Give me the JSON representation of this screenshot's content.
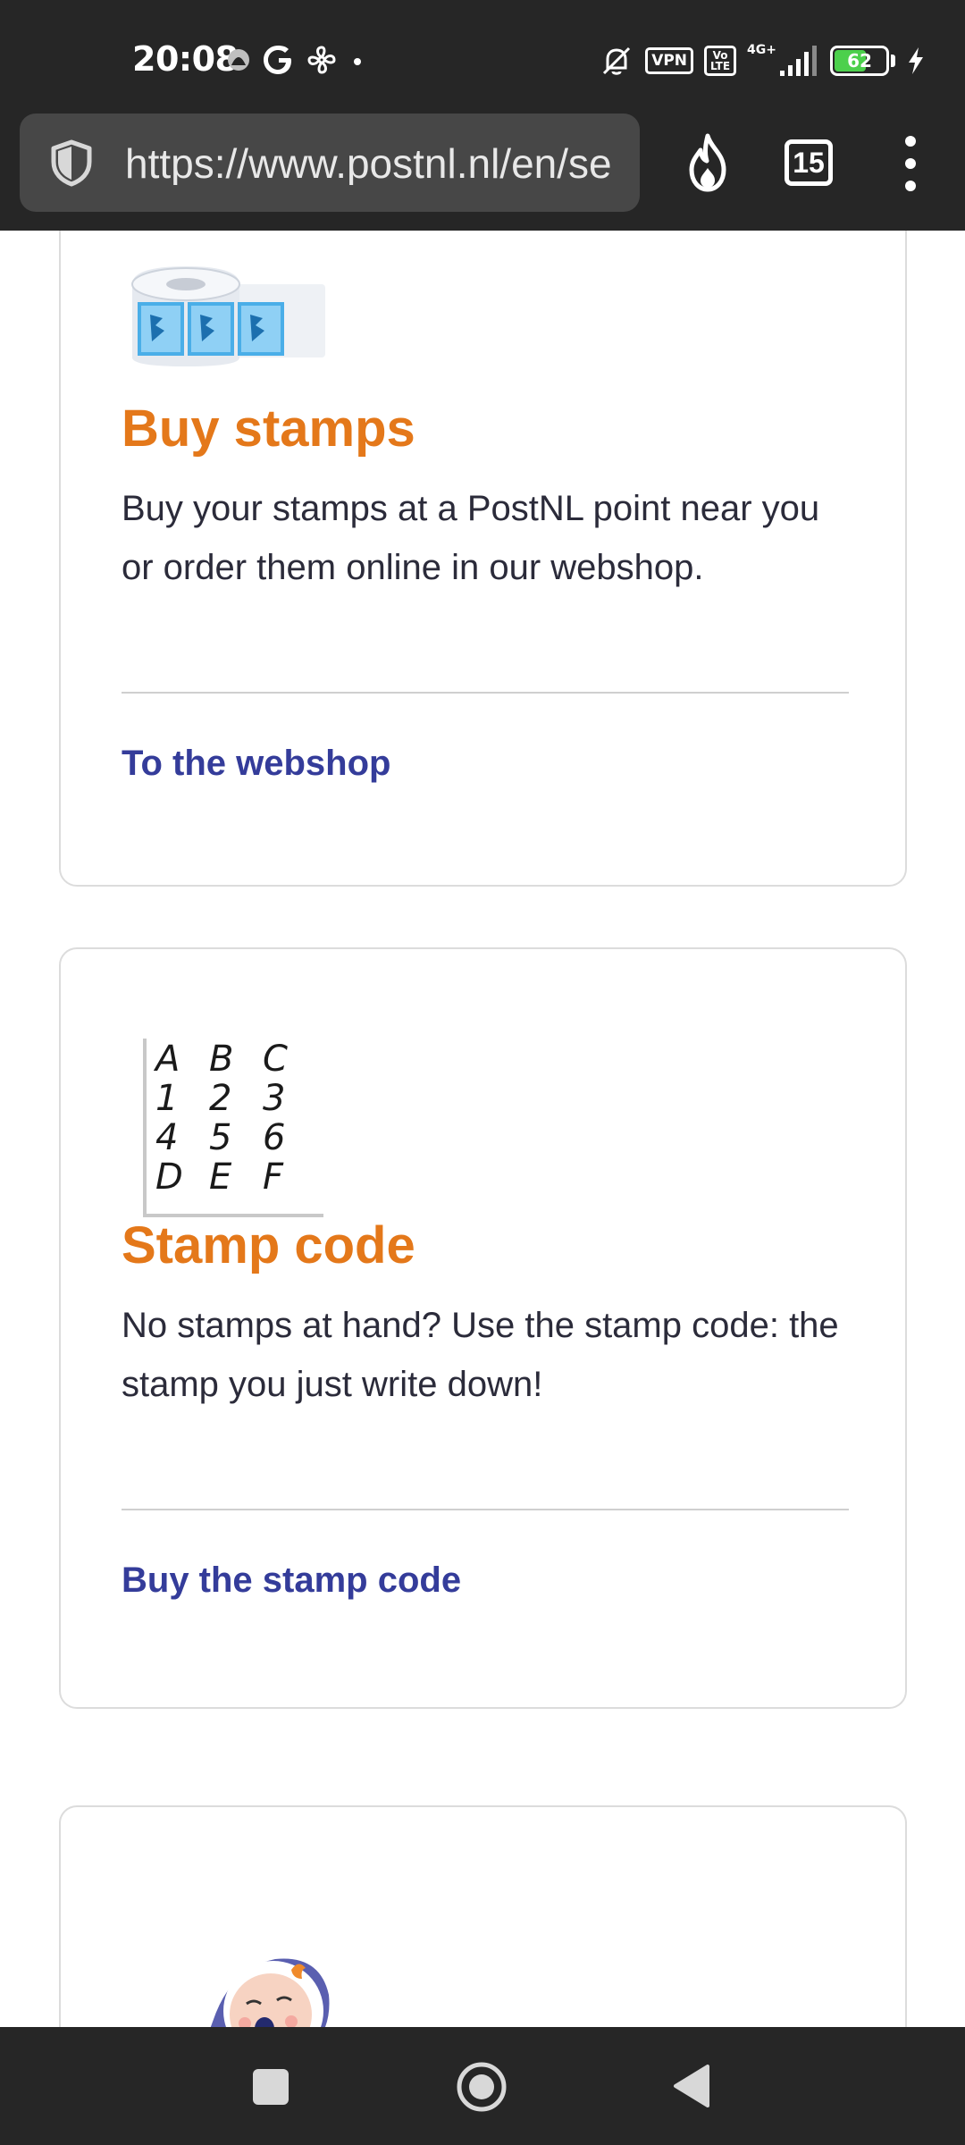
{
  "status_bar": {
    "time": "20:08",
    "left_icons": [
      "data-saver-icon",
      "google-icon",
      "fan-icon",
      "dot-icon"
    ],
    "vpn_label": "VPN",
    "volte_top": "Vo",
    "volte_bottom": "LTE",
    "network_label": "4G+",
    "battery_level": "62",
    "battery_fraction": 0.62,
    "colors": {
      "battery_fill": "#4cd04c",
      "background": "#262626"
    }
  },
  "browser": {
    "url": "https://www.postnl.nl/en/se",
    "tab_count": "15",
    "icons": [
      "shield-icon",
      "fire-icon",
      "tabs-icon",
      "more-menu-icon"
    ]
  },
  "cards": [
    {
      "illustration": "stamp-roll-illustration",
      "title": "Buy stamps",
      "text": "Buy your stamps at a PostNL point near you or order them online in our webshop.",
      "link": "To the webshop"
    },
    {
      "illustration": "stamp-code-illustration",
      "code_rows": [
        [
          "A",
          "B",
          "C"
        ],
        [
          "1",
          "2",
          "3"
        ],
        [
          "4",
          "5",
          "6"
        ],
        [
          "D",
          "E",
          "F"
        ]
      ],
      "title": "Stamp code",
      "text": "No stamps at hand? Use the stamp code: the stamp you just write down!",
      "link": "Buy the stamp code"
    },
    {
      "illustration": "baby-illustration"
    }
  ],
  "nav_bar": {
    "icons": [
      "recents-icon",
      "home-icon",
      "back-icon"
    ]
  },
  "colors": {
    "title_orange": "#e4781a",
    "link_blue": "#343c9a",
    "body_text": "#2b2b3a",
    "card_border": "#dcdcdc"
  }
}
